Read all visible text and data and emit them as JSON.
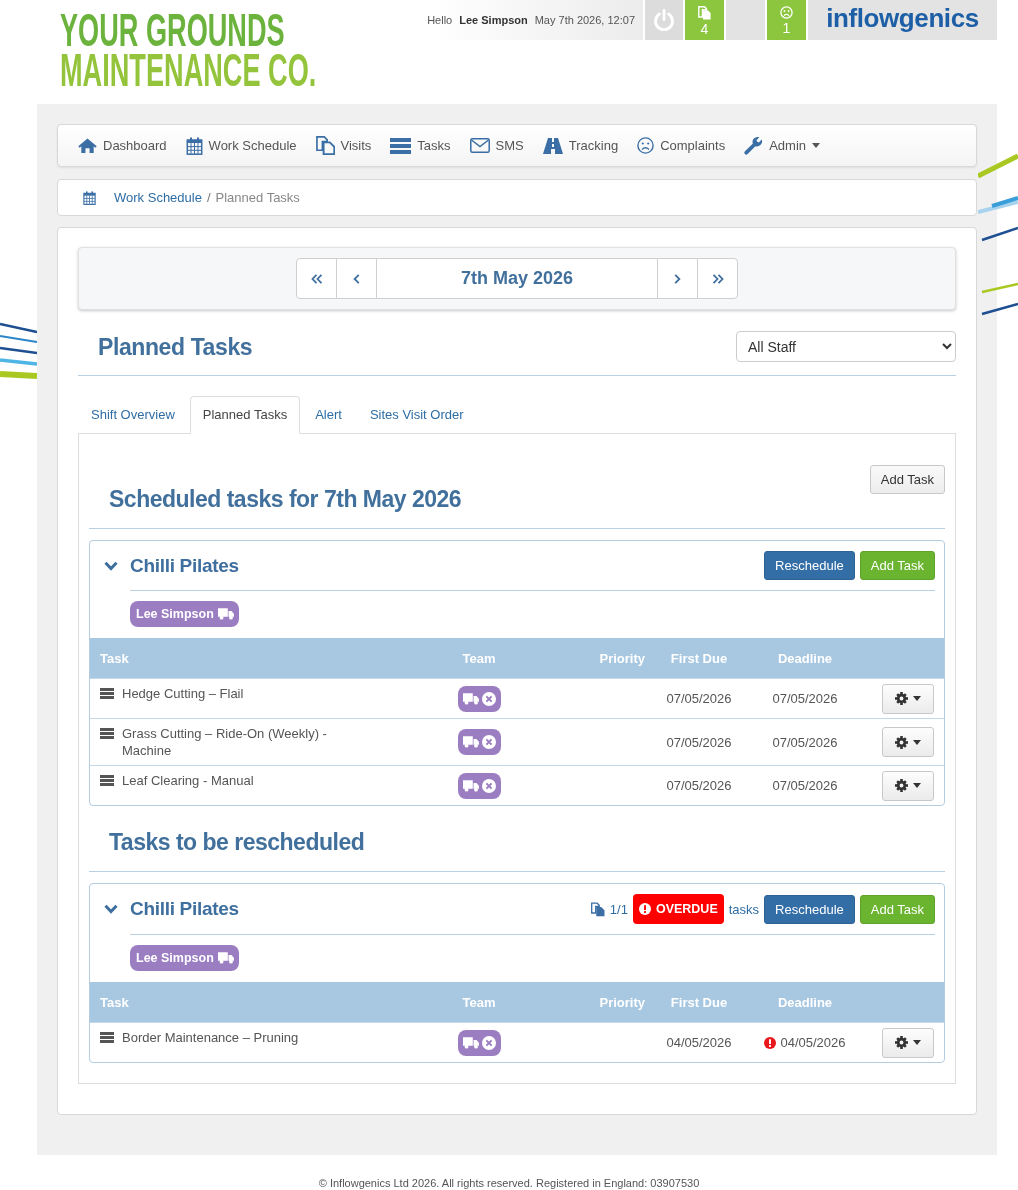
{
  "header": {
    "logo_lines": [
      "YOUR GROUNDS",
      "MAINTENANCE CO."
    ],
    "greeting": "Hello",
    "user_name": "Lee Simpson",
    "datetime": "May 7th 2026, 12:07",
    "counters": [
      "4",
      "1"
    ],
    "brand": "inflowgenics"
  },
  "nav": [
    {
      "label": "Dashboard",
      "dropdown": false
    },
    {
      "label": "Work Schedule",
      "dropdown": false
    },
    {
      "label": "Visits",
      "dropdown": false
    },
    {
      "label": "Tasks",
      "dropdown": false
    },
    {
      "label": "SMS",
      "dropdown": false
    },
    {
      "label": "Tracking",
      "dropdown": false
    },
    {
      "label": "Complaints",
      "dropdown": false
    },
    {
      "label": "Admin",
      "dropdown": true
    }
  ],
  "breadcrumb": {
    "items": [
      {
        "label": "Work Schedule",
        "current": false
      },
      {
        "label": "Planned Tasks",
        "current": true
      }
    ],
    "separator": "/"
  },
  "date_nav": {
    "date": "7th May 2026"
  },
  "page_title": "Planned Tasks",
  "staff_filter": {
    "value": "All Staff"
  },
  "tabs": [
    {
      "label": "Shift Overview",
      "selected": false
    },
    {
      "label": "Planned Tasks",
      "selected": true
    },
    {
      "label": "Alert",
      "selected": false
    },
    {
      "label": "Sites Visit Order",
      "selected": false
    }
  ],
  "sections": [
    {
      "heading": "Scheduled tasks for 7th May 2026",
      "action": "Add Task",
      "groups": [
        {
          "site": "Chilli Pilates",
          "expanded": true,
          "buttons": [
            {
              "label": "Reschedule",
              "kind": "primary"
            },
            {
              "label": "Add Task",
              "kind": "success"
            }
          ],
          "staff": [
            "Lee Simpson"
          ],
          "columns": [
            "Task",
            "Team",
            "Priority",
            "First Due",
            "Deadline"
          ],
          "rows": [
            {
              "task": "Hedge Cutting – Flail",
              "first_due": "07/05/2026",
              "deadline": "07/05/2026",
              "overdue": false
            },
            {
              "task": "Grass Cutting – Ride-On (Weekly) - Machine",
              "first_due": "07/05/2026",
              "deadline": "07/05/2026",
              "overdue": false
            },
            {
              "task": "Leaf Clearing - Manual",
              "first_due": "07/05/2026",
              "deadline": "07/05/2026",
              "overdue": false
            }
          ]
        }
      ]
    },
    {
      "heading": "Tasks to be rescheduled",
      "groups": [
        {
          "site": "Chilli Pilates",
          "expanded": true,
          "summary": {
            "count": "1/1",
            "badge": "OVERDUE",
            "suffix": "tasks"
          },
          "buttons": [
            {
              "label": "Reschedule",
              "kind": "primary"
            },
            {
              "label": "Add Task",
              "kind": "success"
            }
          ],
          "staff": [
            "Lee Simpson"
          ],
          "columns": [
            "Task",
            "Team",
            "Priority",
            "First Due",
            "Deadline"
          ],
          "rows": [
            {
              "task": "Border Maintenance – Pruning",
              "first_due": "04/05/2026",
              "deadline": "04/05/2026",
              "overdue": true
            }
          ]
        }
      ]
    }
  ],
  "footer": "© Inflowgenics Ltd 2026. All rights reserved. Registered in England: 03907530"
}
